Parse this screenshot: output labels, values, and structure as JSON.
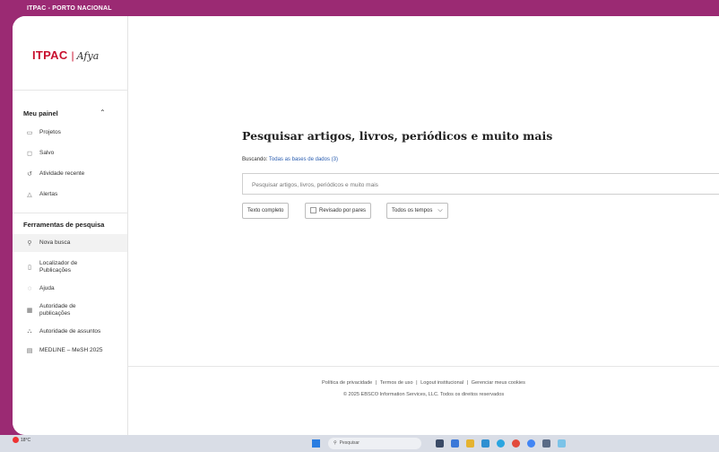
{
  "window_caption": "ITPAC - PORTO NACIONAL",
  "logo": {
    "brand": "ITPAC",
    "separator": "|",
    "partner": "Afya"
  },
  "panel": {
    "title": "Meu painel",
    "items": [
      {
        "icon": "chat-icon",
        "label": "Projetos"
      },
      {
        "icon": "folder-icon",
        "label": "Salvo"
      },
      {
        "icon": "history-icon",
        "label": "Atividade recente"
      },
      {
        "icon": "bell-icon",
        "label": "Alertas"
      }
    ]
  },
  "tools": {
    "title": "Ferramentas de pesquisa",
    "items": [
      {
        "icon": "search-icon",
        "label": "Nova busca"
      },
      {
        "icon": "document-icon",
        "label": "Localizador de Publicações"
      },
      {
        "icon": "help-icon",
        "label": "Ajuda"
      },
      {
        "icon": "grid-icon",
        "label": "Autoridade de publicações"
      },
      {
        "icon": "hierarchy-icon",
        "label": "Autoridade de assuntos"
      },
      {
        "icon": "book-icon",
        "label": "MEDLINE – MeSH 2025"
      }
    ]
  },
  "main": {
    "heading": "Pesquisar artigos, livros, periódicos e muito mais",
    "scope_label": "Buscando:",
    "scope_link": "Todas as bases de dados (3)",
    "search_placeholder": "Pesquisar artigos, livros, periódicos e muito mais",
    "filters": {
      "full_text": "Texto completo",
      "peer_reviewed": "Revisado por pares",
      "all_time": "Todos os tempos"
    }
  },
  "footer": {
    "links": [
      "Política de privacidade",
      "Termos de uso",
      "Logout institucional",
      "Gerenciar meus cookies"
    ],
    "separator": "|",
    "copyright": "© 2025 EBSCO Information Services, LLC. Todos os direitos reservados"
  },
  "taskbar": {
    "weather_temp": "18°C",
    "search_placeholder": "Pesquisar",
    "colors": {
      "start": "#2a7de1",
      "weather_dot": "#e33333"
    }
  }
}
